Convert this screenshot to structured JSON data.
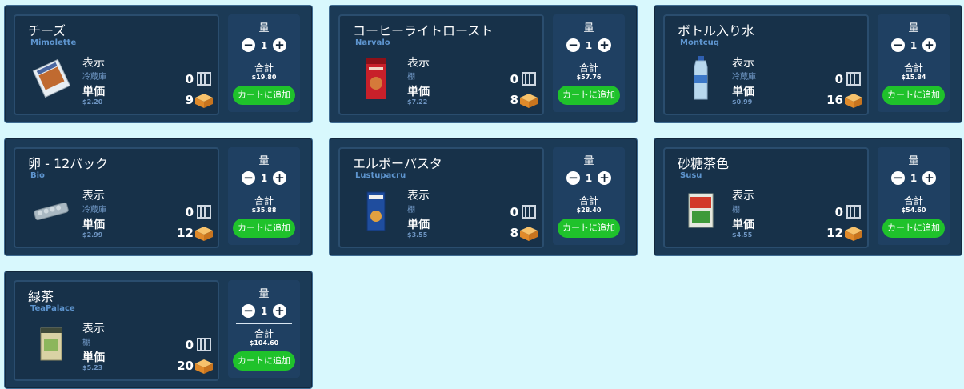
{
  "labels": {
    "quantity": "量",
    "total": "合計",
    "display": "表示",
    "unit_price": "単価",
    "add_to_cart": "カートに追加",
    "minus": "−",
    "plus": "+"
  },
  "colors": {
    "background": "#d8f8fd",
    "card": "#1b3a56",
    "accent_green": "#1fc22b",
    "brand_text": "#5e95cf"
  },
  "products": [
    {
      "name": "チーズ",
      "brand": "Mimolette",
      "display": "冷蔵庫",
      "price": "$2.20",
      "qty": "1",
      "total": "$19.80",
      "shelf_count": "0",
      "stock_count": "9",
      "image": "cheese-package"
    },
    {
      "name": "コーヒーライトロースト",
      "brand": "Narvalo",
      "display": "棚",
      "price": "$7.22",
      "qty": "1",
      "total": "$57.76",
      "shelf_count": "0",
      "stock_count": "8",
      "image": "coffee-bag"
    },
    {
      "name": "ボトル入り水",
      "brand": "Montcuq",
      "display": "冷蔵庫",
      "price": "$0.99",
      "qty": "1",
      "total": "$15.84",
      "shelf_count": "0",
      "stock_count": "16",
      "image": "water-bottle"
    },
    {
      "name": "卵 - 12パック",
      "brand": "Bio",
      "display": "冷蔵庫",
      "price": "$2.99",
      "qty": "1",
      "total": "$35.88",
      "shelf_count": "0",
      "stock_count": "12",
      "image": "egg-carton"
    },
    {
      "name": "エルボーパスタ",
      "brand": "Lustupacru",
      "display": "棚",
      "price": "$3.55",
      "qty": "1",
      "total": "$28.40",
      "shelf_count": "0",
      "stock_count": "8",
      "image": "pasta-box"
    },
    {
      "name": "砂糖茶色",
      "brand": "Susu",
      "display": "棚",
      "price": "$4.55",
      "qty": "1",
      "total": "$54.60",
      "shelf_count": "0",
      "stock_count": "12",
      "image": "sugar-box"
    },
    {
      "name": "緑茶",
      "brand": "TeaPalace",
      "display": "棚",
      "price": "$5.23",
      "qty": "1",
      "total": "$104.60",
      "shelf_count": "0",
      "stock_count": "20",
      "image": "tea-tin"
    }
  ]
}
